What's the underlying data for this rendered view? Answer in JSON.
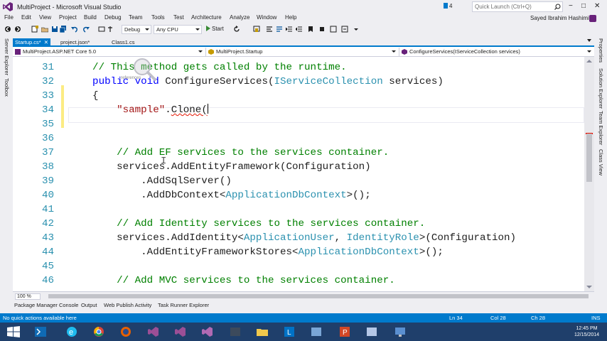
{
  "window": {
    "title": "MultiProject - Microsoft Visual Studio",
    "notification_count": "4",
    "quick_launch_placeholder": "Quick Launch (Ctrl+Q)",
    "minimize": "−",
    "maximize": "□",
    "close": "✕"
  },
  "menu": [
    "File",
    "Edit",
    "View",
    "Project",
    "Build",
    "Debug",
    "Team",
    "Tools",
    "Test",
    "Architecture",
    "Analyze",
    "Window",
    "Help"
  ],
  "user": {
    "name": "Sayed Ibrahim Hashimi"
  },
  "toolbar": {
    "configuration": "Debug",
    "platform": "Any CPU",
    "start_label": "Start"
  },
  "left_tabs": [
    "Server Explorer",
    "Toolbox"
  ],
  "right_tabs": [
    "Properties",
    "Solution Explorer",
    "Team Explorer",
    "Class View"
  ],
  "doc_tabs": [
    {
      "label": "Startup.cs*",
      "active": true
    },
    {
      "label": "project.json*",
      "active": false
    },
    {
      "label": "Class1.cs",
      "active": false
    }
  ],
  "navbar": {
    "project": "MultiProject.ASP.NET Core 5.0",
    "type": "MultiProject.Startup",
    "member": "ConfigureServices(IServiceCollection services)"
  },
  "editor": {
    "references_hint": "references",
    "lines": [
      {
        "n": "31",
        "tokens": [
          [
            "cm",
            "    // This method gets called by the runtime."
          ]
        ]
      },
      {
        "n": "32",
        "tokens": [
          [
            "kw",
            "    public void "
          ],
          [
            "",
            "ConfigureServices("
          ],
          [
            "ty",
            "IServiceCollection"
          ],
          [
            "",
            " services)"
          ]
        ]
      },
      {
        "n": "33",
        "tokens": [
          [
            "",
            "    {"
          ]
        ]
      },
      {
        "n": "34",
        "tokens": [
          [
            "st",
            "        \"sample\""
          ],
          [
            "",
            "."
          ],
          [
            "sq",
            "Clone("
          ]
        ]
      },
      {
        "n": "35",
        "tokens": []
      },
      {
        "n": "36",
        "tokens": []
      },
      {
        "n": "37",
        "tokens": [
          [
            "cm",
            "        // Add EF services to the services container."
          ]
        ]
      },
      {
        "n": "38",
        "tokens": [
          [
            "",
            "        services.AddEntityFramework(Configuration)"
          ]
        ]
      },
      {
        "n": "39",
        "tokens": [
          [
            "",
            "            .AddSqlServer()"
          ]
        ]
      },
      {
        "n": "40",
        "tokens": [
          [
            "",
            "            .AddDbContext<"
          ],
          [
            "ty",
            "ApplicationDbContext"
          ],
          [
            "",
            ">();"
          ]
        ]
      },
      {
        "n": "41",
        "tokens": []
      },
      {
        "n": "42",
        "tokens": [
          [
            "cm",
            "        // Add Identity services to the services container."
          ]
        ]
      },
      {
        "n": "43",
        "tokens": [
          [
            "",
            "        services.AddIdentity<"
          ],
          [
            "ty",
            "ApplicationUser"
          ],
          [
            "",
            ", "
          ],
          [
            "ty",
            "IdentityRole"
          ],
          [
            "",
            ">(Configuration)"
          ]
        ]
      },
      {
        "n": "44",
        "tokens": [
          [
            "",
            "            .AddEntityFrameworkStores<"
          ],
          [
            "ty",
            "ApplicationDbContext"
          ],
          [
            "",
            ">();"
          ]
        ]
      },
      {
        "n": "45",
        "tokens": []
      },
      {
        "n": "46",
        "tokens": [
          [
            "cm",
            "        // Add MVC services to the services container."
          ]
        ]
      }
    ]
  },
  "zoom": "100 %",
  "tool_tabs": [
    "Package Manager Console",
    "Output",
    "Web Publish Activity",
    "Task Runner Explorer"
  ],
  "status": {
    "message": "No quick actions available here",
    "ln": "Ln 34",
    "col": "Col 28",
    "ch": "Ch 28",
    "ins": "INS"
  },
  "taskbar": {
    "time": "12:45 PM",
    "date": "12/15/2014"
  },
  "colors": {
    "accent": "#007acc",
    "keyword": "#0000ff",
    "type": "#2b91af",
    "comment": "#008000",
    "string": "#a31515"
  }
}
